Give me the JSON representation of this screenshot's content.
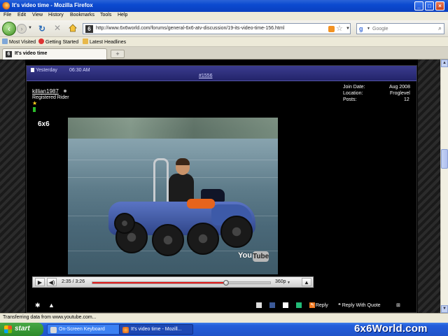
{
  "window": {
    "title": "It's video time - Mozilla Firefox"
  },
  "menu": [
    "File",
    "Edit",
    "View",
    "History",
    "Bookmarks",
    "Tools",
    "Help"
  ],
  "nav": {
    "url": "http://www.6x6world.com/forums/general-6x6-atv-discussion/19-its-video-time-156.html",
    "site_icon_text": "6",
    "search_engine_letter": "g",
    "search_placeholder": "Google"
  },
  "bookmarks": [
    "Most Visited",
    "Getting Started",
    "Latest Headlines"
  ],
  "tab": {
    "title": "It's video time",
    "icon_text": "6",
    "new_tab_label": "+"
  },
  "post": {
    "date": "Yesterday",
    "time": "06:30 AM",
    "number": "#1556",
    "username": "killian1987",
    "user_title": "Registered Rider",
    "rep_star": "★",
    "join_date_label": "Join Date:",
    "join_date": "Aug 2008",
    "location_label": "Location:",
    "location": "Froglevel",
    "posts_label": "Posts:",
    "posts": "12",
    "message": "6x6",
    "actions": {
      "reply": "Reply",
      "reply_with_quote": "Reply With Quote"
    }
  },
  "video": {
    "logo_you": "You",
    "logo_tube": "Tube",
    "time_display": "2:35 / 3:26",
    "progress": 0.75,
    "quality": "360p"
  },
  "status": {
    "text": "Transferring data from www.youtube.com..."
  },
  "taskbar": {
    "start": "start",
    "tasks": [
      "On-Screen Keyboard",
      "It's video time - Mozill..."
    ],
    "watermark": "6x6World.com"
  },
  "colors": {
    "titlebar": "#0b4ad0",
    "post_header": "#2b2c7a",
    "progress": "#e21b1b",
    "taskbar": "#245edb",
    "start": "#2c8a2a"
  }
}
